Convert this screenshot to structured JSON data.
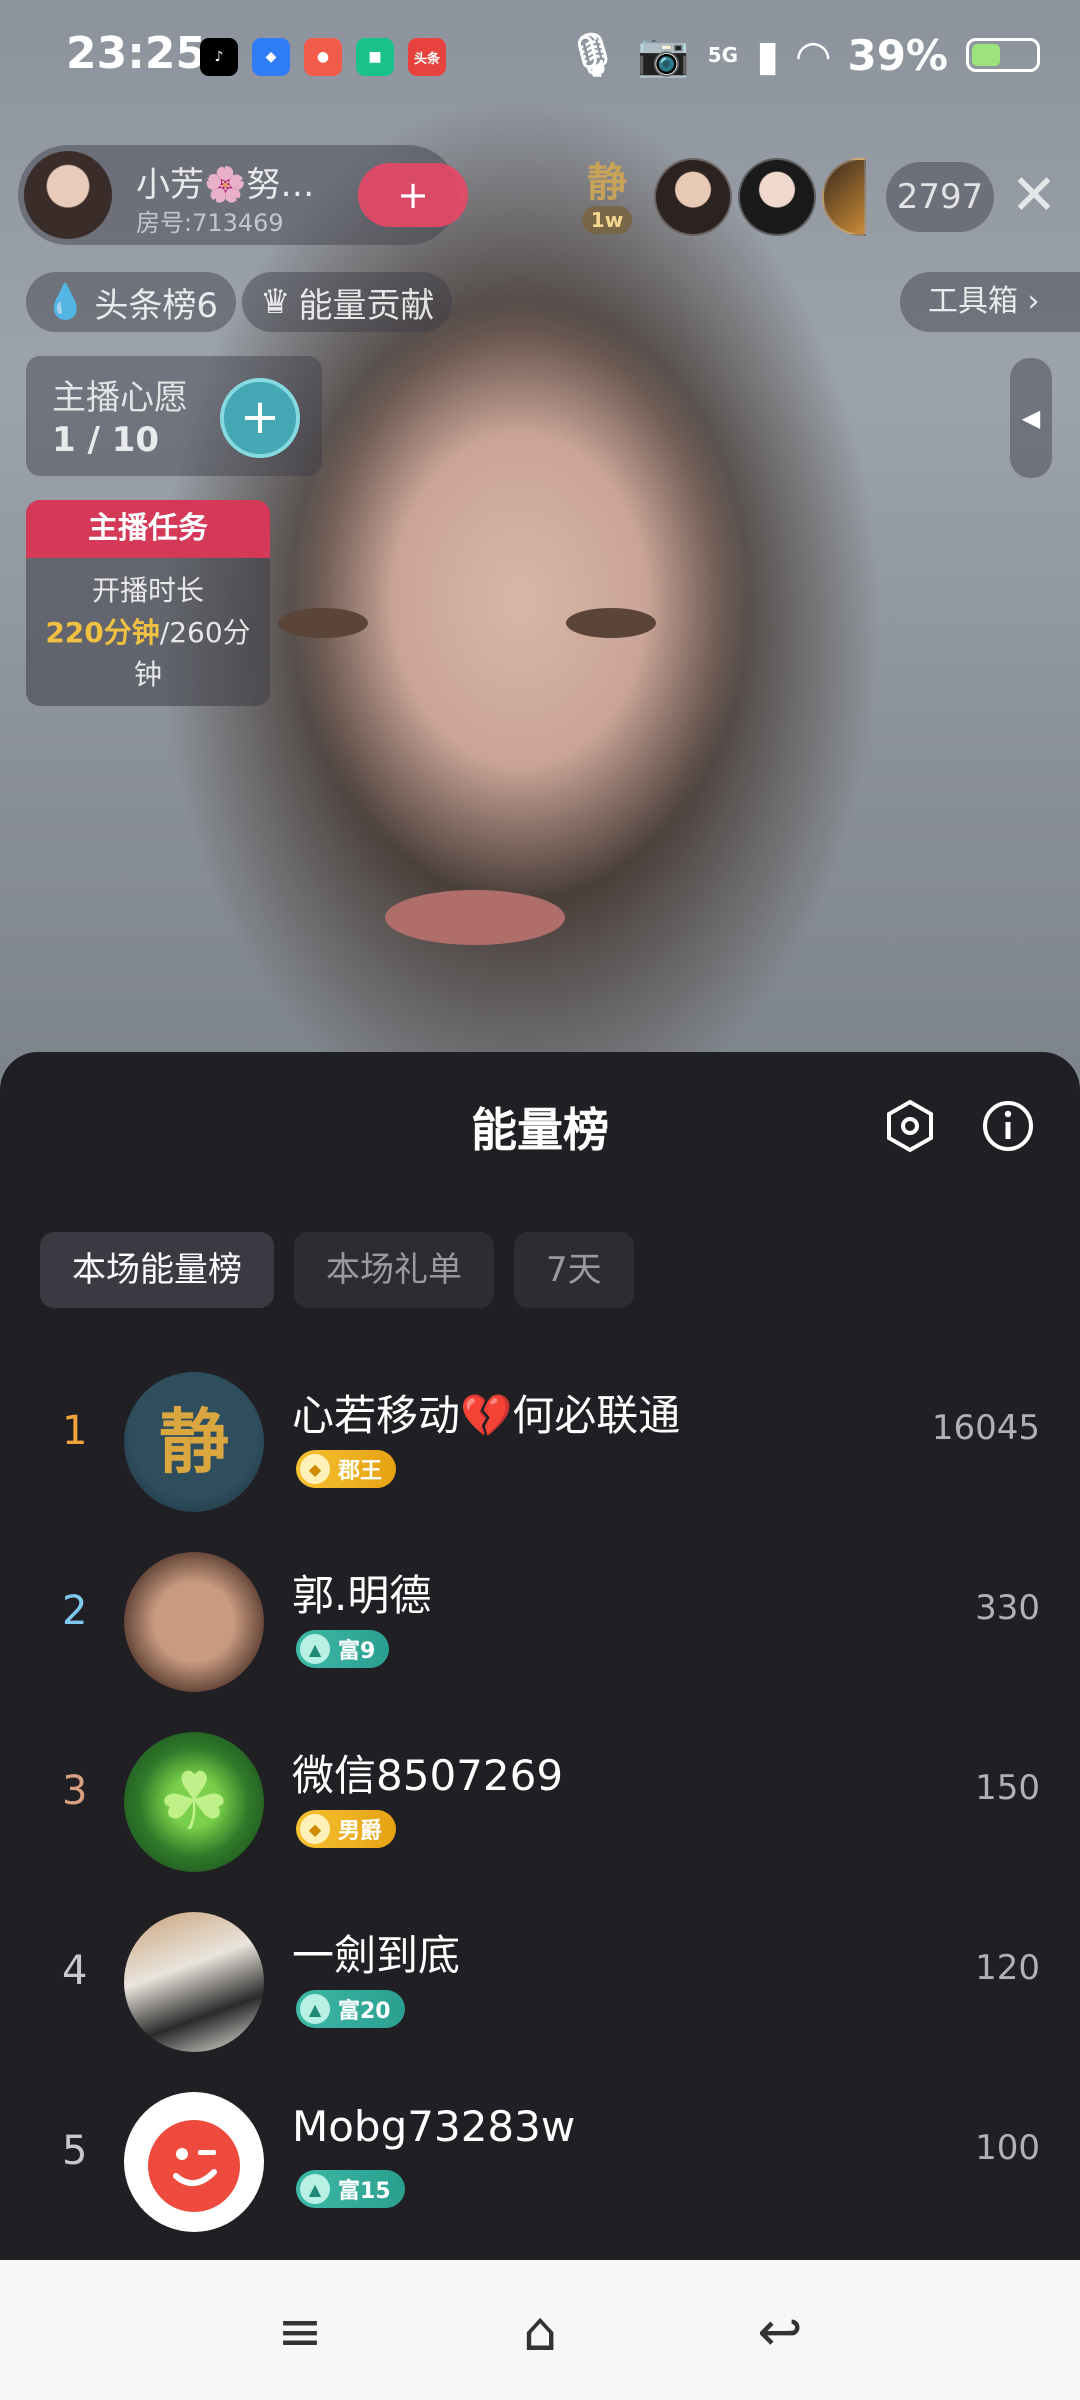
{
  "status_bar": {
    "time": "23:25",
    "apps": [
      {
        "name": "tiktok-icon",
        "color": "#000000",
        "glyph": "♪"
      },
      {
        "name": "app-store-icon",
        "color": "#2e7cf6",
        "glyph": "◆"
      },
      {
        "name": "map-icon",
        "color": "#f25a4a",
        "glyph": "●"
      },
      {
        "name": "box-app-icon",
        "color": "#18c28a",
        "glyph": "■"
      },
      {
        "name": "toutiao-icon",
        "color": "#e8423e",
        "glyph": "头条"
      }
    ],
    "network": "5G",
    "battery": "39%"
  },
  "live_room": {
    "host_name": "小芳🌸努…",
    "room_id": "房号:713469",
    "follow_label": "+",
    "top_fan_glyph": "静",
    "top_fan_badge": "1w",
    "viewer_count": "2797",
    "close_label": "✕",
    "chips": [
      {
        "icon": "fire-icon",
        "label": "头条榜6"
      },
      {
        "icon": "crown-icon",
        "label": "能量贡献"
      }
    ],
    "toolbox_label": "工具箱 ›",
    "wish": {
      "title": "主播心愿",
      "count": "1 / 10",
      "add_label": "+"
    },
    "task": {
      "title": "主播任务",
      "line1": "开播时长",
      "progress": "220分钟",
      "target": "/260分钟"
    }
  },
  "sheet": {
    "title": "能量榜",
    "tabs": [
      {
        "label": "本场能量榜",
        "active": true
      },
      {
        "label": "本场礼单",
        "active": false
      },
      {
        "label": "7天",
        "active": false
      }
    ],
    "rows": [
      {
        "rank": "1",
        "rank_color": "#f2a33a",
        "name": "心若移动💔何必联通",
        "badge": "郡王",
        "badge_type": "gold",
        "score": "16045"
      },
      {
        "rank": "2",
        "rank_color": "#7fc8f0",
        "name": "郭.明德",
        "badge": "富9",
        "badge_type": "green",
        "score": "330"
      },
      {
        "rank": "3",
        "rank_color": "#d8a080",
        "name": "微信8507269",
        "badge": "男爵",
        "badge_type": "gold",
        "score": "150"
      },
      {
        "rank": "4",
        "rank_color": "#c8c8cc",
        "name": "一劍到底",
        "badge": "富20",
        "badge_type": "green",
        "score": "120"
      },
      {
        "rank": "5",
        "rank_color": "#c8c8cc",
        "name": "Mobg73283w",
        "badge": "富15",
        "badge_type": "green",
        "score": "100"
      }
    ]
  },
  "nav": {
    "menu": "≡",
    "home": "⌂",
    "back": "↩"
  }
}
